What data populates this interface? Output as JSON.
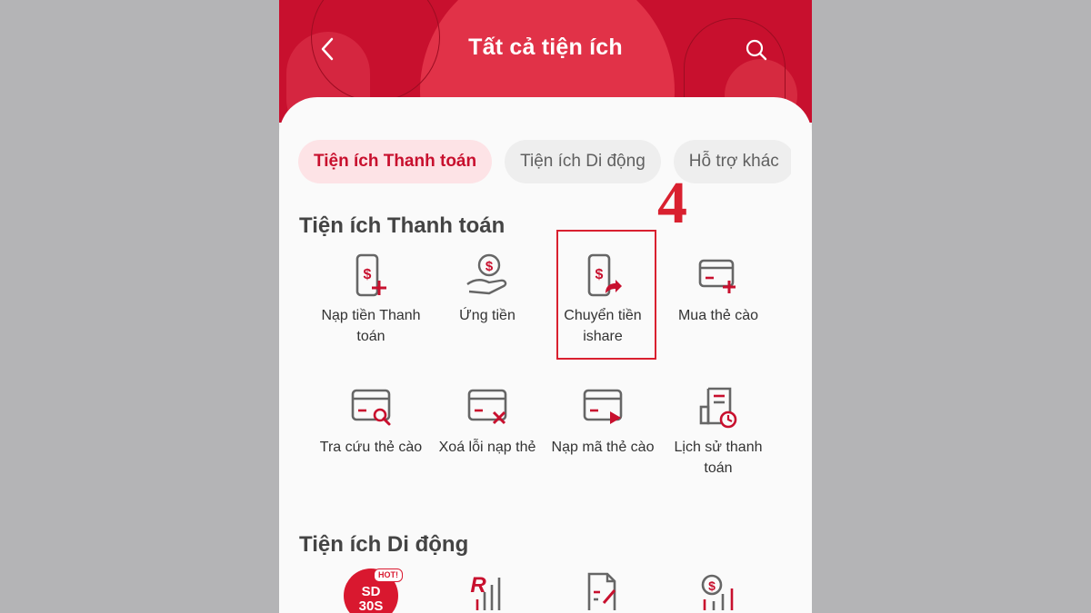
{
  "header": {
    "title": "Tất cả tiện ích",
    "back_icon": "chevron-left-icon",
    "search_icon": "search-icon",
    "background_color": "#c8102e"
  },
  "tabs": [
    {
      "label": "Tiện ích Thanh toán",
      "active": true
    },
    {
      "label": "Tiện ích Di động",
      "active": false
    },
    {
      "label": "Hỗ trợ khác",
      "active": false
    }
  ],
  "sections": {
    "payment": {
      "title": "Tiện ích Thanh toán",
      "items": [
        {
          "label": "Nạp tiền Thanh toán",
          "icon": "phone-dollar-plus-icon"
        },
        {
          "label": "Ứng tiền",
          "icon": "hand-coin-icon"
        },
        {
          "label": "Chuyển tiền ishare",
          "icon": "phone-dollar-share-icon"
        },
        {
          "label": "Mua thẻ cào",
          "icon": "card-plus-icon"
        },
        {
          "label": "Tra cứu thẻ cào",
          "icon": "card-search-icon"
        },
        {
          "label": "Xoá lỗi nạp thẻ",
          "icon": "card-remove-icon"
        },
        {
          "label": "Nạp mã thẻ cào",
          "icon": "card-play-icon"
        },
        {
          "label": "Lịch sử thanh toán",
          "icon": "receipt-clock-icon"
        }
      ]
    },
    "mobile": {
      "title": "Tiện ích Di động",
      "items": [
        {
          "badge_text": "SD 30S",
          "hot_label": "HOT!",
          "icon": "sd30s-logo-icon"
        },
        {
          "icon": "r-signal-icon"
        },
        {
          "icon": "document-edit-icon"
        },
        {
          "icon": "coin-signal-icon"
        }
      ]
    }
  },
  "annotation": {
    "step_number": "4",
    "highlight_color": "#d9202f"
  },
  "colors": {
    "accent": "#c8102e",
    "icon_gray": "#666666",
    "active_tab_bg": "#fde3e6"
  }
}
